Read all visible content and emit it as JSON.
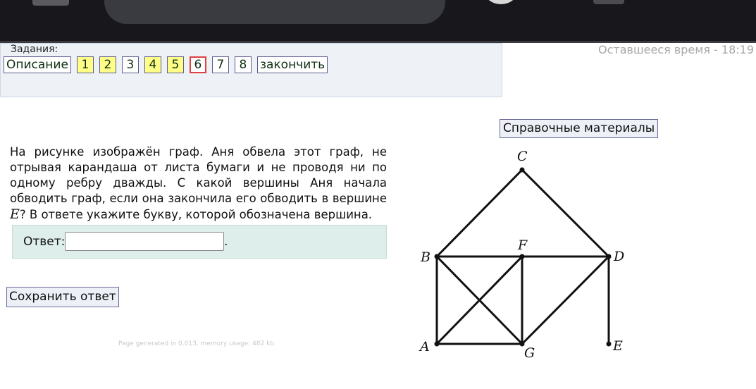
{
  "header": {
    "tasks_label": "Задания:",
    "tabs": [
      "Описание",
      "1",
      "2",
      "3",
      "4",
      "5",
      "6",
      "7",
      "8",
      "закончить"
    ],
    "tab_states": [
      "normal",
      "done",
      "done",
      "normal",
      "done",
      "done",
      "current",
      "normal",
      "normal",
      "normal"
    ],
    "timer": "Оставшееся время - 18:19"
  },
  "reference_button": "Справочные материалы",
  "problem": {
    "text_before": "На рисунке изображён граф. Аня обвела этот граф, не отрывая карандаша от листа бумаги и не проводя ни по одному ребру дважды. С какой вершины Аня начала обводить граф, если она закончила его обводить в вершине ",
    "vertex": "E",
    "text_after": "? В ответе укажите букву, которой обозначена вершина."
  },
  "answer": {
    "label": "Ответ:",
    "value": "",
    "suffix": "."
  },
  "save_button": "Сохранить ответ",
  "footer_note": "Page generated in 0.013, memory usage: 482 kb",
  "graph": {
    "vertex_labels": {
      "A": "A",
      "B": "B",
      "C": "C",
      "D": "D",
      "E": "E",
      "F": "F",
      "G": "G"
    },
    "edges": [
      [
        "C",
        "B"
      ],
      [
        "C",
        "D"
      ],
      [
        "B",
        "F"
      ],
      [
        "F",
        "D"
      ],
      [
        "B",
        "A"
      ],
      [
        "A",
        "G"
      ],
      [
        "F",
        "G"
      ],
      [
        "D",
        "E"
      ],
      [
        "B",
        "G"
      ],
      [
        "A",
        "F"
      ],
      [
        "G",
        "D"
      ]
    ]
  },
  "colors": {
    "topbar": "#18181c",
    "done_tab": "#ffff88",
    "current_tab_border": "#e04040",
    "answer_bg": "#deefeb",
    "timer": "#a8a8a8"
  }
}
